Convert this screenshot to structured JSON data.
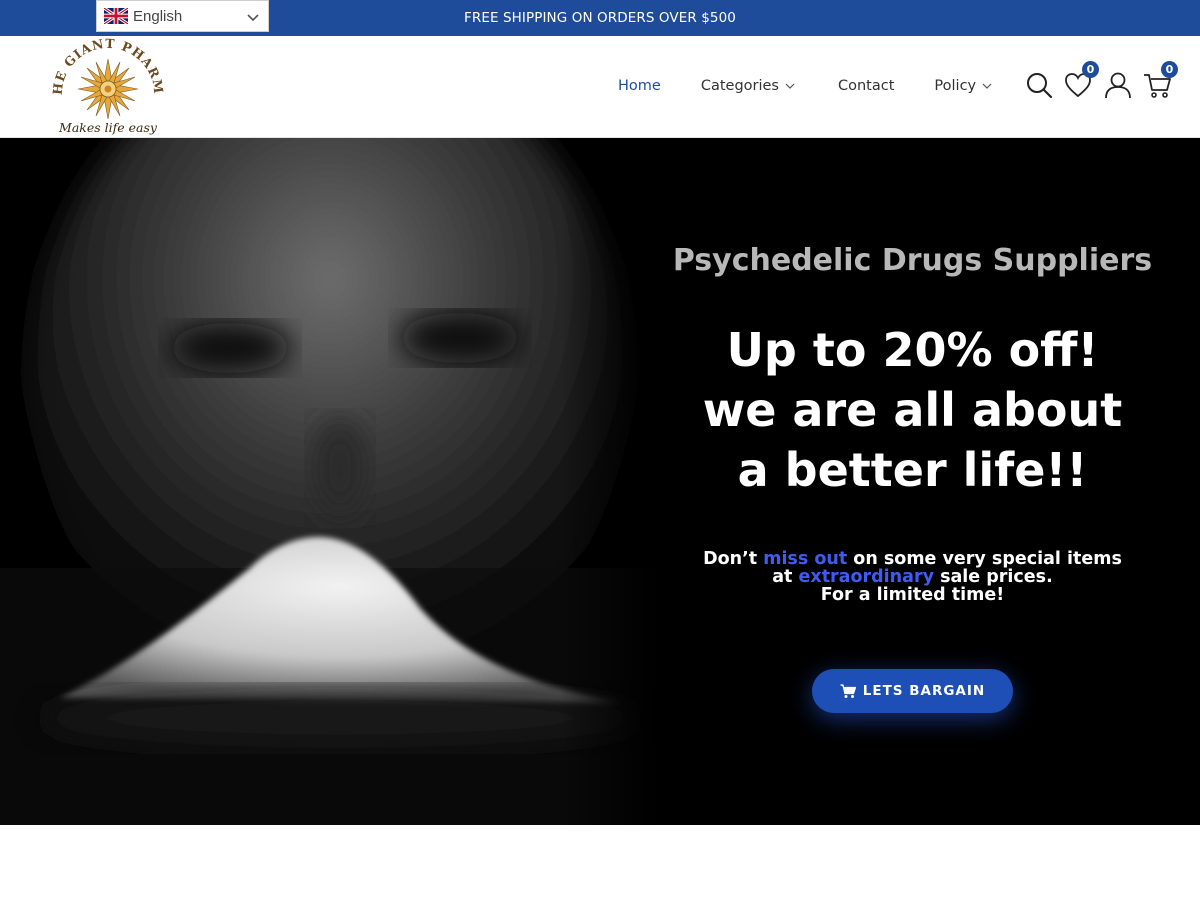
{
  "topbar": {
    "language": "English",
    "promo": "FREE SHIPPING ON ORDERS OVER $500"
  },
  "header": {
    "logo_text": "THE GIANT PHARMA",
    "logo_tagline": "Makes life easy",
    "nav": [
      {
        "label": "Home",
        "active": true,
        "dropdown": false
      },
      {
        "label": "Categories",
        "active": false,
        "dropdown": true
      },
      {
        "label": "Contact",
        "active": false,
        "dropdown": false
      },
      {
        "label": "Policy",
        "active": false,
        "dropdown": true
      }
    ],
    "icons": [
      "search-icon",
      "heart-icon",
      "user-icon",
      "cart-icon"
    ],
    "wishlist_count": "0",
    "cart_count": "0"
  },
  "hero": {
    "title": "Psychedelic Drugs Suppliers",
    "headline": [
      "Up to 20% off!",
      "we are all about",
      "a better life!!"
    ],
    "text": {
      "part1": "Don’t ",
      "highlight1": "miss out",
      "part2": " on some very special items",
      "part3": "at ",
      "highlight2": "extraordinary",
      "part4": " sale prices.",
      "line3": "For a limited time!"
    },
    "cta_label": "LETS BARGAIN"
  },
  "colors": {
    "brand_blue": "#1f4c9a",
    "highlight": "#3f5cf2",
    "button": "#1e4fb6"
  }
}
